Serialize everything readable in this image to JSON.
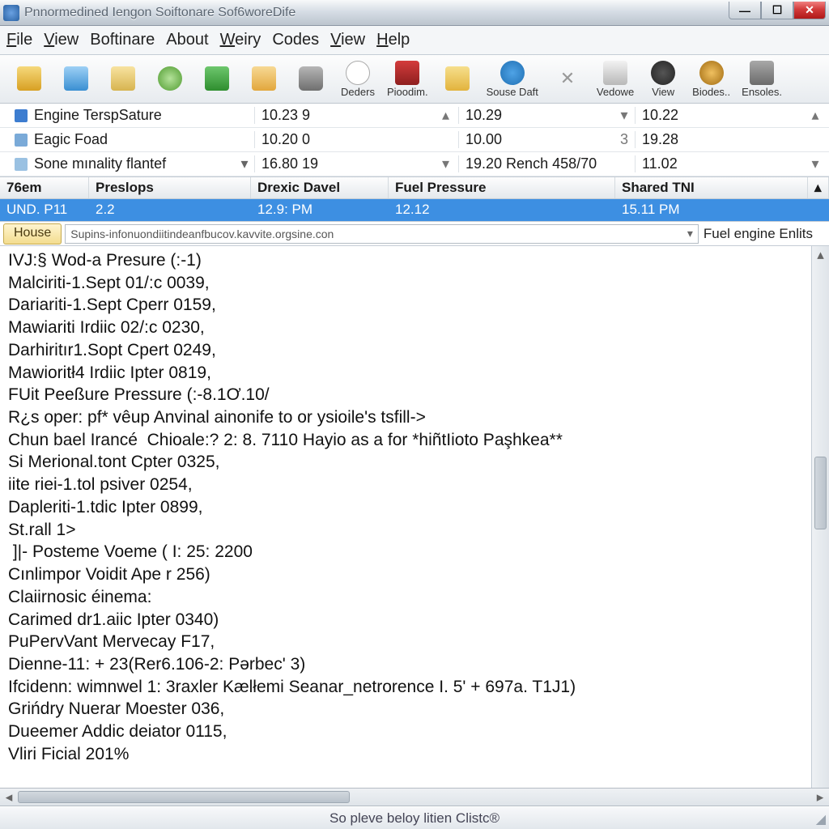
{
  "window": {
    "title": "Pnnormedined Iengon Soiftonare Sof6woreDife"
  },
  "menu": [
    "File",
    "View",
    "Boftinare",
    "About",
    "Weiry",
    "Codes",
    "View",
    "Help"
  ],
  "menu_underline": [
    0,
    0,
    -1,
    -1,
    0,
    -1,
    0,
    0
  ],
  "toolbar": [
    {
      "icon": "lock",
      "label": ""
    },
    {
      "icon": "img",
      "label": ""
    },
    {
      "icon": "fold",
      "label": ""
    },
    {
      "icon": "refr",
      "label": ""
    },
    {
      "icon": "s",
      "label": ""
    },
    {
      "icon": "card",
      "label": ""
    },
    {
      "icon": "db",
      "label": ""
    },
    {
      "icon": "3",
      "label": "Deders"
    },
    {
      "icon": "h",
      "label": "Pioodim."
    },
    {
      "icon": "sun",
      "label": ""
    },
    {
      "icon": "blue",
      "label": "Souse Daft"
    },
    {
      "icon": "x",
      "label": ""
    },
    {
      "icon": "pen",
      "label": "Vedowe"
    },
    {
      "icon": "gear",
      "label": "View"
    },
    {
      "icon": "orb",
      "label": "Biodes.."
    },
    {
      "icon": "cube",
      "label": "Ensoles."
    }
  ],
  "monitors": [
    {
      "sq": "a",
      "name": "Engine TerspSature",
      "dd": "",
      "c1": "10.23 9",
      "e1": "▴",
      "c2": "10.29",
      "e2": "▾",
      "c3": "10.22",
      "e3": "▴"
    },
    {
      "sq": "b",
      "name": "Eagic Foad",
      "dd": "",
      "c1": "10.20 0",
      "e1": "",
      "c2": "10.00",
      "e2": "3",
      "c3": "19.28",
      "e3": ""
    },
    {
      "sq": "c",
      "name": "Sone mınality flantef",
      "dd": "▾",
      "c1": "16.80 19",
      "e1": "▾",
      "c2": "19.20 Rench 458/70",
      "e2": "",
      "c3": "11.02",
      "e3": "▾"
    }
  ],
  "table": {
    "columns": [
      "76em",
      "Preslops",
      "Drexic Davel",
      "Fuel Pressure",
      "Shared TNI"
    ],
    "row": [
      "UND. P11",
      "2.2",
      "12.9: PM",
      "12.12",
      "15.11 PM"
    ]
  },
  "housebar": {
    "button": "House",
    "path": "Supins-infonuondiitindeanfbucov.kavvite.orgsine.con",
    "right": "Fuel engine Enlits"
  },
  "log_lines": [
    "IVJ:§ Wod-a Presure (:-1)",
    "Malciriti-1.Sept 01/:c 0039,",
    "Dariariti-1.Sept Cperr 0159,",
    "Mawiariti Irdiic 02/:c 0230,",
    "Darhiritır1.Sopt Cpert 0249,",
    "Mawioritł4 Irdiic Ipter 0819,",
    "FUit Peeßure Pressure (:-8.1Ơ.10/",
    "R¿s oper: pf* vêup Anvinal ainonife to or ysioile's tsfill->",
    "Chun bael Irancé  Chioale:? 2: 8. 7110 Hayio as a for *hiñtIioto Paşhkea**",
    "Si Merional.tont Cpter 0325,",
    "iite riei-1.tol psiver 0254,",
    "Dapleriti-1.tdic Ipter 0899,",
    "St.rall 1>",
    " ]|- Posteme Voeme ( I: 25: 2200",
    "Cınlimpor Voidit Ape r 256)",
    "Claiirnosic éinema:",
    "Carimed dr1.aiic Ipter 0340)",
    "PuPervVant Mervecay F17,",
    "Dienne-11: + 23(Rer6.106-2: Pərbeс' 3)",
    "Ifcidenn: wimnwel 1: 3raxler Kælłemi Seanar_netrorence I. 5' + 697a. T1J1)",
    "Grińdry Nuerar Moester 036,",
    "Dueemer Addic deiator 0115,",
    "Vliri Ficial 201%"
  ],
  "status": "So pleve beloy litien Clistc®"
}
